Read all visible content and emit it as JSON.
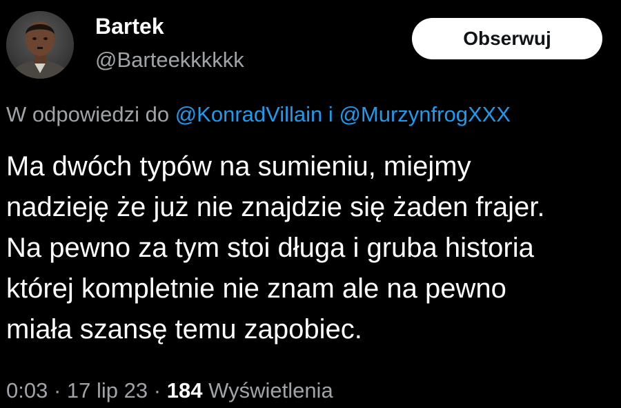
{
  "author": {
    "display_name": "Bartek",
    "handle": "@Barteekkkkkk",
    "avatar_icon": "profile-photo"
  },
  "follow_button": {
    "label": "Obserwuj"
  },
  "reply_context": {
    "prefix": "W odpowiedzi do",
    "mentions": [
      "@KonradVillain",
      "@MurzynfrogXXX"
    ],
    "separator": "i"
  },
  "tweet": {
    "lines": [
      "Ma dwóch typów na sumieniu, miejmy",
      "nadzieję że już nie znajdzie się żaden frajer.",
      "Na pewno za tym stoi długa i gruba historia",
      "której kompletnie nie znam ale na pewno",
      "miała szansę temu zapobiec."
    ]
  },
  "meta": {
    "time": "0:03",
    "dot": "·",
    "date": "17 lip 23",
    "views_count": "184",
    "views_label": "Wyświetlenia"
  },
  "colors": {
    "background": "#000000",
    "text": "#ffffff",
    "secondary_text": "#a0a4a8",
    "link": "#1d9bf0",
    "button_bg": "#ffffff",
    "button_text": "#0f1419"
  }
}
